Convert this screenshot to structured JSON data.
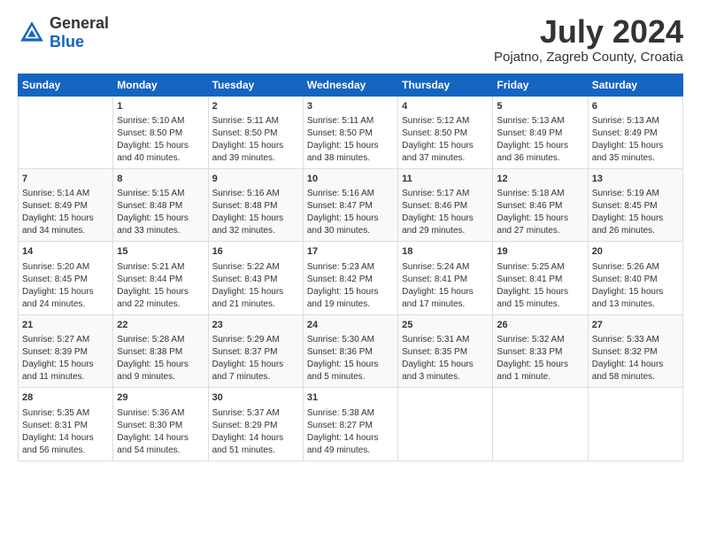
{
  "header": {
    "logo": {
      "general": "General",
      "blue": "Blue"
    },
    "title": "July 2024",
    "subtitle": "Pojatno, Zagreb County, Croatia"
  },
  "calendar": {
    "days_of_week": [
      "Sunday",
      "Monday",
      "Tuesday",
      "Wednesday",
      "Thursday",
      "Friday",
      "Saturday"
    ],
    "weeks": [
      [
        {
          "day": "",
          "data": ""
        },
        {
          "day": "1",
          "data": "Sunrise: 5:10 AM\nSunset: 8:50 PM\nDaylight: 15 hours\nand 40 minutes."
        },
        {
          "day": "2",
          "data": "Sunrise: 5:11 AM\nSunset: 8:50 PM\nDaylight: 15 hours\nand 39 minutes."
        },
        {
          "day": "3",
          "data": "Sunrise: 5:11 AM\nSunset: 8:50 PM\nDaylight: 15 hours\nand 38 minutes."
        },
        {
          "day": "4",
          "data": "Sunrise: 5:12 AM\nSunset: 8:50 PM\nDaylight: 15 hours\nand 37 minutes."
        },
        {
          "day": "5",
          "data": "Sunrise: 5:13 AM\nSunset: 8:49 PM\nDaylight: 15 hours\nand 36 minutes."
        },
        {
          "day": "6",
          "data": "Sunrise: 5:13 AM\nSunset: 8:49 PM\nDaylight: 15 hours\nand 35 minutes."
        }
      ],
      [
        {
          "day": "7",
          "data": "Sunrise: 5:14 AM\nSunset: 8:49 PM\nDaylight: 15 hours\nand 34 minutes."
        },
        {
          "day": "8",
          "data": "Sunrise: 5:15 AM\nSunset: 8:48 PM\nDaylight: 15 hours\nand 33 minutes."
        },
        {
          "day": "9",
          "data": "Sunrise: 5:16 AM\nSunset: 8:48 PM\nDaylight: 15 hours\nand 32 minutes."
        },
        {
          "day": "10",
          "data": "Sunrise: 5:16 AM\nSunset: 8:47 PM\nDaylight: 15 hours\nand 30 minutes."
        },
        {
          "day": "11",
          "data": "Sunrise: 5:17 AM\nSunset: 8:46 PM\nDaylight: 15 hours\nand 29 minutes."
        },
        {
          "day": "12",
          "data": "Sunrise: 5:18 AM\nSunset: 8:46 PM\nDaylight: 15 hours\nand 27 minutes."
        },
        {
          "day": "13",
          "data": "Sunrise: 5:19 AM\nSunset: 8:45 PM\nDaylight: 15 hours\nand 26 minutes."
        }
      ],
      [
        {
          "day": "14",
          "data": "Sunrise: 5:20 AM\nSunset: 8:45 PM\nDaylight: 15 hours\nand 24 minutes."
        },
        {
          "day": "15",
          "data": "Sunrise: 5:21 AM\nSunset: 8:44 PM\nDaylight: 15 hours\nand 22 minutes."
        },
        {
          "day": "16",
          "data": "Sunrise: 5:22 AM\nSunset: 8:43 PM\nDaylight: 15 hours\nand 21 minutes."
        },
        {
          "day": "17",
          "data": "Sunrise: 5:23 AM\nSunset: 8:42 PM\nDaylight: 15 hours\nand 19 minutes."
        },
        {
          "day": "18",
          "data": "Sunrise: 5:24 AM\nSunset: 8:41 PM\nDaylight: 15 hours\nand 17 minutes."
        },
        {
          "day": "19",
          "data": "Sunrise: 5:25 AM\nSunset: 8:41 PM\nDaylight: 15 hours\nand 15 minutes."
        },
        {
          "day": "20",
          "data": "Sunrise: 5:26 AM\nSunset: 8:40 PM\nDaylight: 15 hours\nand 13 minutes."
        }
      ],
      [
        {
          "day": "21",
          "data": "Sunrise: 5:27 AM\nSunset: 8:39 PM\nDaylight: 15 hours\nand 11 minutes."
        },
        {
          "day": "22",
          "data": "Sunrise: 5:28 AM\nSunset: 8:38 PM\nDaylight: 15 hours\nand 9 minutes."
        },
        {
          "day": "23",
          "data": "Sunrise: 5:29 AM\nSunset: 8:37 PM\nDaylight: 15 hours\nand 7 minutes."
        },
        {
          "day": "24",
          "data": "Sunrise: 5:30 AM\nSunset: 8:36 PM\nDaylight: 15 hours\nand 5 minutes."
        },
        {
          "day": "25",
          "data": "Sunrise: 5:31 AM\nSunset: 8:35 PM\nDaylight: 15 hours\nand 3 minutes."
        },
        {
          "day": "26",
          "data": "Sunrise: 5:32 AM\nSunset: 8:33 PM\nDaylight: 15 hours\nand 1 minute."
        },
        {
          "day": "27",
          "data": "Sunrise: 5:33 AM\nSunset: 8:32 PM\nDaylight: 14 hours\nand 58 minutes."
        }
      ],
      [
        {
          "day": "28",
          "data": "Sunrise: 5:35 AM\nSunset: 8:31 PM\nDaylight: 14 hours\nand 56 minutes."
        },
        {
          "day": "29",
          "data": "Sunrise: 5:36 AM\nSunset: 8:30 PM\nDaylight: 14 hours\nand 54 minutes."
        },
        {
          "day": "30",
          "data": "Sunrise: 5:37 AM\nSunset: 8:29 PM\nDaylight: 14 hours\nand 51 minutes."
        },
        {
          "day": "31",
          "data": "Sunrise: 5:38 AM\nSunset: 8:27 PM\nDaylight: 14 hours\nand 49 minutes."
        },
        {
          "day": "",
          "data": ""
        },
        {
          "day": "",
          "data": ""
        },
        {
          "day": "",
          "data": ""
        }
      ]
    ]
  }
}
